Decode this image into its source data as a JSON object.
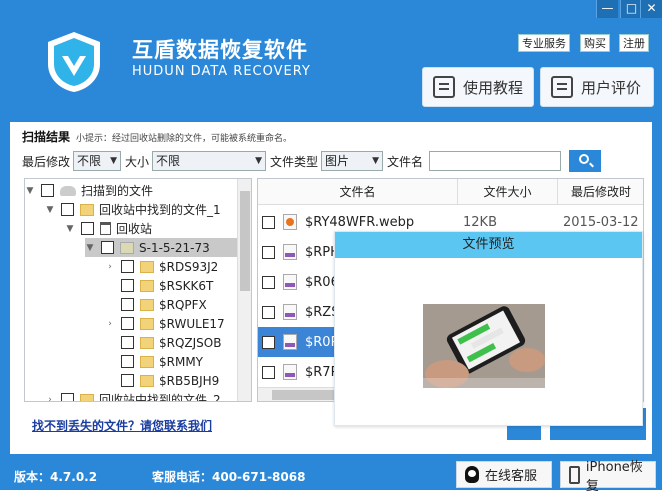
{
  "window_controls": {
    "minimize": "—",
    "close": "✕"
  },
  "header": {
    "title_cn": "互盾数据恢复软件",
    "title_en": "HUDUN DATA RECOVERY",
    "links": [
      "专业服务",
      "购买",
      "注册"
    ],
    "tutorial_btn": "使用教程",
    "review_btn": "用户评价"
  },
  "scan": {
    "title": "扫描结果",
    "hint": "小提示：经过回收站删除的文件，可能被系统重命名。"
  },
  "filters": {
    "last_modified_label": "最后修改",
    "last_modified_value": "不限",
    "size_label": "大小",
    "size_value": "不限",
    "file_type_label": "文件类型",
    "file_type_value": "图片",
    "file_name_label": "文件名",
    "file_name_value": ""
  },
  "tree": [
    {
      "label": "扫描到的文件",
      "level": 0,
      "twisty": "▼",
      "icon": "disk"
    },
    {
      "label": "回收站中找到的文件_1",
      "level": 1,
      "twisty": "▼",
      "icon": "folder"
    },
    {
      "label": "回收站",
      "level": 2,
      "twisty": "▼",
      "icon": "bin"
    },
    {
      "label": "S-1-5-21-73",
      "level": 3,
      "twisty": "▼",
      "icon": "folder",
      "selected": true
    },
    {
      "label": "$RDS93J2",
      "level": 4,
      "twisty": "›",
      "icon": "folder"
    },
    {
      "label": "$RSKK6T",
      "level": 4,
      "twisty": "",
      "icon": "folder"
    },
    {
      "label": "$RQPFX",
      "level": 4,
      "twisty": "",
      "icon": "folder"
    },
    {
      "label": "$RWULE17",
      "level": 4,
      "twisty": "›",
      "icon": "folder"
    },
    {
      "label": "$RQZJSOB",
      "level": 4,
      "twisty": "",
      "icon": "folder"
    },
    {
      "label": "$RMMY",
      "level": 4,
      "twisty": "",
      "icon": "folder"
    },
    {
      "label": "$RB5BJH9",
      "level": 4,
      "twisty": "",
      "icon": "folder"
    },
    {
      "label": "回收站中找到的文件_2",
      "level": 1,
      "twisty": "›",
      "icon": "folder"
    }
  ],
  "file_list": {
    "headers": [
      "文件名",
      "文件大小",
      "最后修改时"
    ],
    "rows": [
      {
        "name": "$RY48WFR.webp",
        "size": "12KB",
        "date": "2015-03-12",
        "icon": "webp",
        "highlight": false
      },
      {
        "name": "$RPH",
        "size": "",
        "date": "",
        "icon": "img",
        "highlight": false
      },
      {
        "name": "$R06",
        "size": "",
        "date": "",
        "icon": "img",
        "highlight": false
      },
      {
        "name": "$RZS",
        "size": "",
        "date": "",
        "icon": "img",
        "highlight": false
      },
      {
        "name": "$R0P",
        "size": "",
        "date": "",
        "icon": "img",
        "highlight": true
      },
      {
        "name": "$R7P",
        "size": "",
        "date": "",
        "icon": "img",
        "highlight": false
      }
    ]
  },
  "preview": {
    "title": "文件预览"
  },
  "help_link": "找不到丢失的文件？请您联系我们",
  "footer": {
    "version": "版本：4.7.0.2",
    "phone": "客服电话：400-671-8068",
    "online_service": "在线客服",
    "iphone_recovery": "iPhone恢复"
  }
}
